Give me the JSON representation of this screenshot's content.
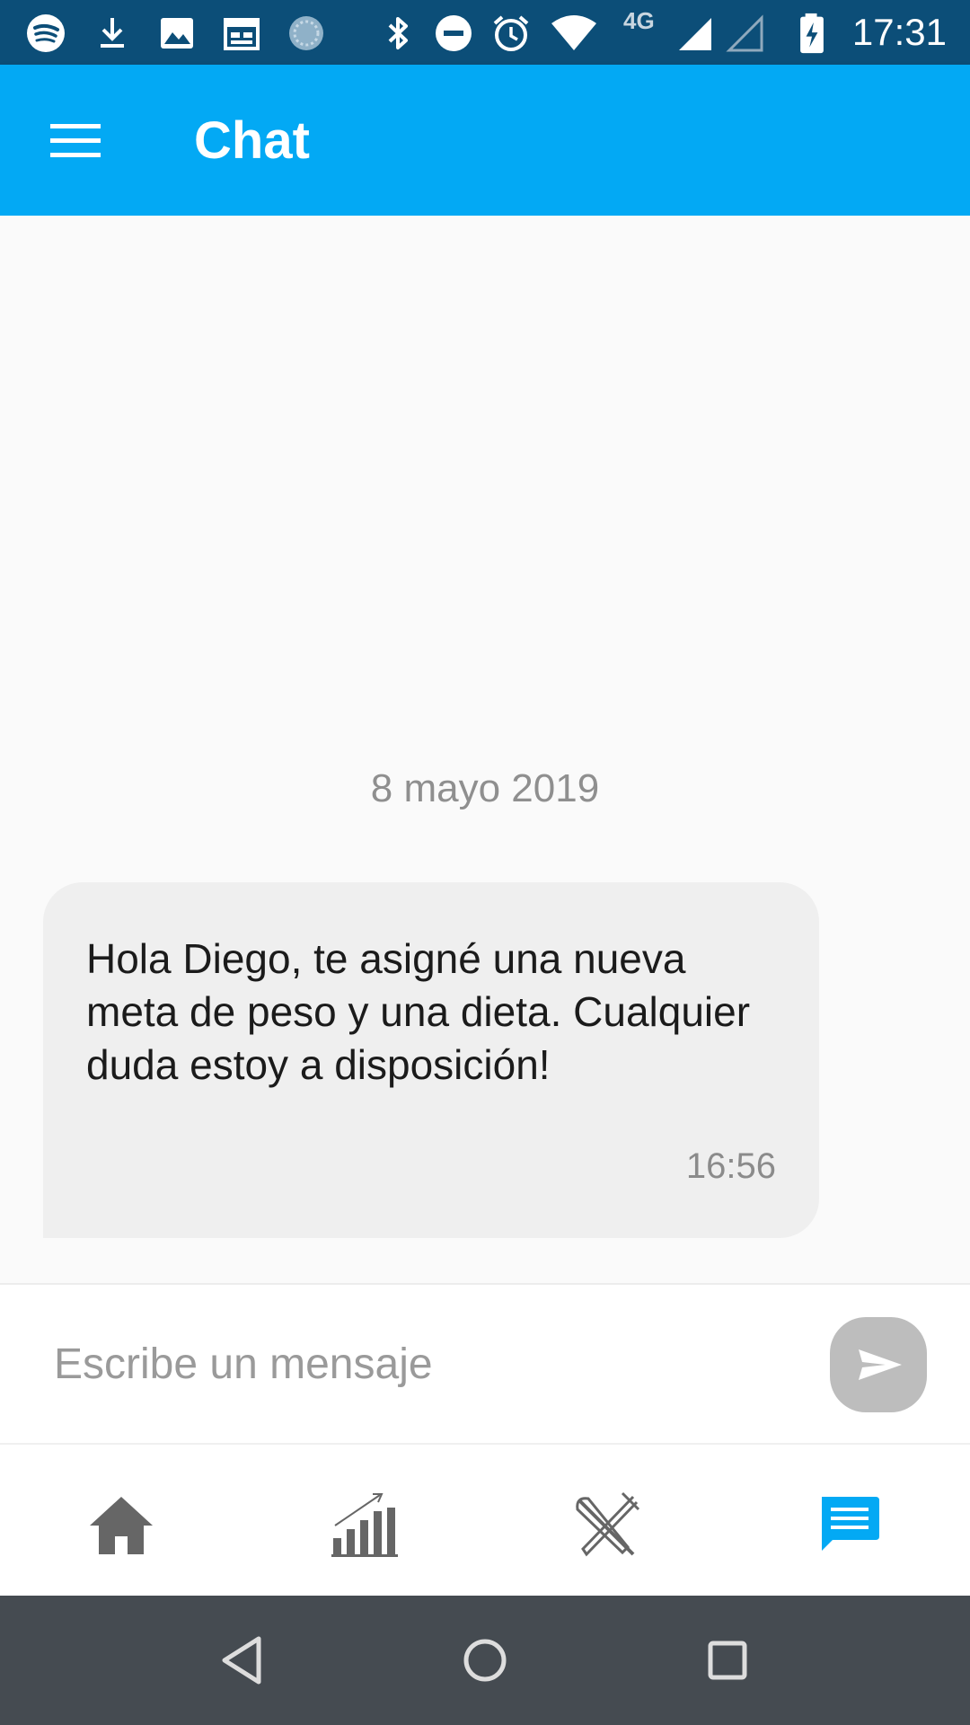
{
  "status_bar": {
    "time": "17:31",
    "network_label": "4G",
    "icons": [
      "spotify-icon",
      "download-icon",
      "image-icon",
      "calendar-icon",
      "sync-icon",
      "bluetooth-icon",
      "do-not-disturb-icon",
      "alarm-icon",
      "wifi-icon",
      "signal-icon",
      "signal-empty-icon",
      "battery-charging-icon"
    ]
  },
  "app_bar": {
    "title": "Chat",
    "menu_icon": "hamburger-menu-icon"
  },
  "chat": {
    "date_separator": "8 mayo 2019",
    "messages": [
      {
        "text": "Hola Diego, te asigné una nueva meta de peso y una dieta. Cualquier duda estoy a disposición!",
        "time": "16:56"
      }
    ]
  },
  "composer": {
    "placeholder": "Escribe un mensaje",
    "value": "",
    "send_icon": "send-icon"
  },
  "bottom_nav": {
    "items": [
      {
        "icon": "home-icon",
        "active": false
      },
      {
        "icon": "progress-chart-icon",
        "active": false
      },
      {
        "icon": "fork-knife-icon",
        "active": false
      },
      {
        "icon": "chat-icon",
        "active": true
      }
    ]
  },
  "colors": {
    "status_bar": "#0c4e78",
    "app_bar": "#03a9f4",
    "active_nav": "#03a9f4",
    "inactive_nav": "#666666",
    "bubble": "#efefef",
    "send_button": "#bdbdbd",
    "system_nav": "#454b51"
  },
  "system_nav": {
    "buttons": [
      "back-icon",
      "home-circle-icon",
      "recents-icon"
    ]
  }
}
